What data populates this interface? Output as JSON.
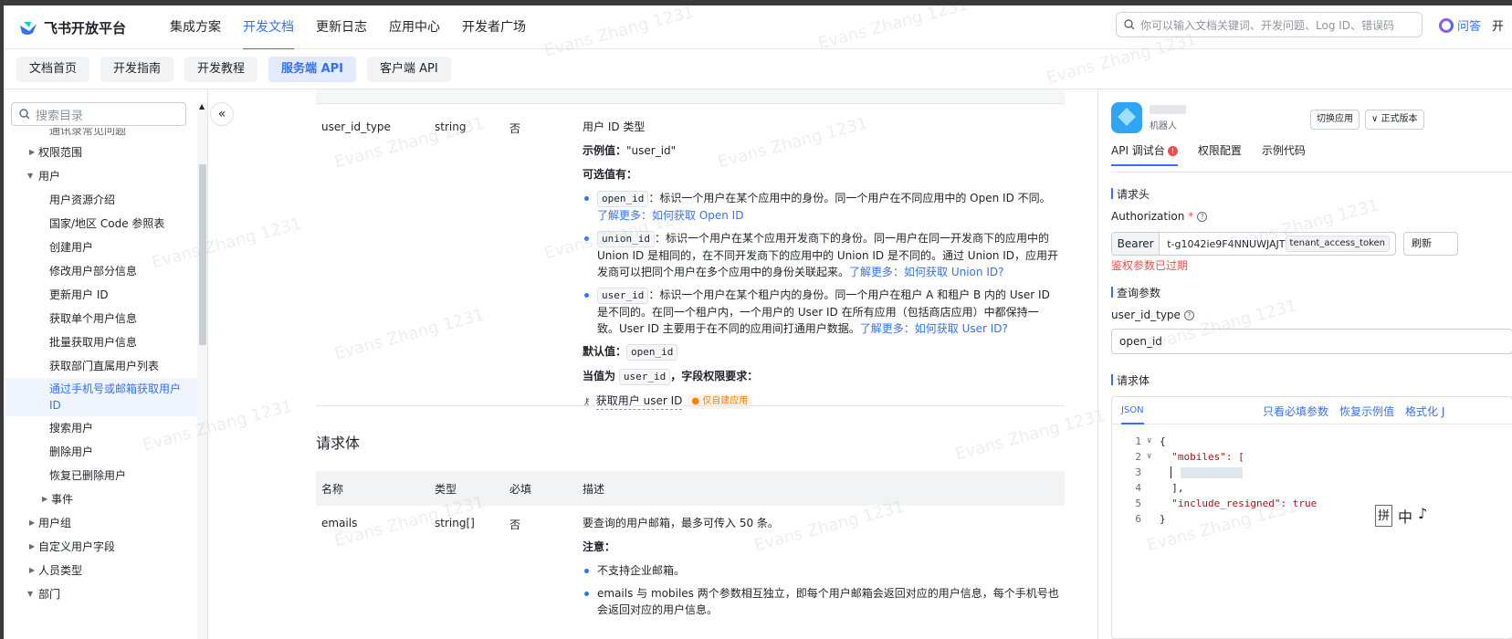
{
  "topbar": {
    "logo_text": "飞书开放平台",
    "nav": [
      "集成方案",
      "开发文档",
      "更新日志",
      "应用中心",
      "开发者广场"
    ],
    "active_nav": "开发文档",
    "search_placeholder": "你可以输入文档关键词、开发问题、Log ID、错误码",
    "ask_label": "问答",
    "more_label": "开"
  },
  "subnav": {
    "tabs": [
      "文档首页",
      "开发指南",
      "开发教程",
      "服务端 API",
      "客户端 API"
    ],
    "active": "服务端 API"
  },
  "sidebar": {
    "search_placeholder": "搜索目录",
    "items": [
      {
        "label": "通讯录常见问题",
        "level": 1,
        "arrow": ""
      },
      {
        "label": "权限范围",
        "level": 0,
        "arrow": "right"
      },
      {
        "label": "用户",
        "level": 0,
        "arrow": "down"
      },
      {
        "label": "用户资源介绍",
        "level": 1,
        "arrow": ""
      },
      {
        "label": "国家/地区 Code 参照表",
        "level": 1,
        "arrow": ""
      },
      {
        "label": "创建用户",
        "level": 1,
        "arrow": ""
      },
      {
        "label": "修改用户部分信息",
        "level": 1,
        "arrow": ""
      },
      {
        "label": "更新用户 ID",
        "level": 1,
        "arrow": ""
      },
      {
        "label": "获取单个用户信息",
        "level": 1,
        "arrow": ""
      },
      {
        "label": "批量获取用户信息",
        "level": 1,
        "arrow": ""
      },
      {
        "label": "获取部门直属用户列表",
        "level": 1,
        "arrow": ""
      },
      {
        "label": "通过手机号或邮箱获取用户 ID",
        "level": 1,
        "arrow": "",
        "selected": true
      },
      {
        "label": "搜索用户",
        "level": 1,
        "arrow": ""
      },
      {
        "label": "删除用户",
        "level": 1,
        "arrow": ""
      },
      {
        "label": "恢复已删除用户",
        "level": 1,
        "arrow": ""
      },
      {
        "label": "事件",
        "level": 2,
        "arrow": "right"
      },
      {
        "label": "用户组",
        "level": 0,
        "arrow": "right"
      },
      {
        "label": "自定义用户字段",
        "level": 0,
        "arrow": "right"
      },
      {
        "label": "人员类型",
        "level": 0,
        "arrow": "right"
      },
      {
        "label": "部门",
        "level": 0,
        "arrow": "down"
      }
    ]
  },
  "main": {
    "query_row": {
      "name": "user_id_type",
      "type": "string",
      "required": "否",
      "title": "用户 ID 类型",
      "example_label": "示例值：",
      "example_value": "\"user_id\"",
      "options_label": "可选值有：",
      "options": [
        {
          "code": "open_id",
          "text": "：标识一个用户在某个应用中的身份。同一个用户在不同应用中的 Open ID 不同。",
          "link": "了解更多：如何获取 Open ID"
        },
        {
          "code": "union_id",
          "text": "：标识一个用户在某个应用开发商下的身份。同一用户在同一开发商下的应用中的 Union ID 是相同的，在不同开发商下的应用中的 Union ID 是不同的。通过 Union ID，应用开发商可以把同个用户在多个应用中的身份关联起来。",
          "link": "了解更多：如何获取 Union ID?"
        },
        {
          "code": "user_id",
          "text": "：标识一个用户在某个租户内的身份。同一个用户在租户 A 和租户 B 内的 User ID 是不同的。在同一个租户内，一个用户的 User ID 在所有应用（包括商店应用）中都保持一致。User ID 主要用于在不同的应用间打通用户数据。",
          "link": "了解更多：如何获取 User ID?"
        }
      ],
      "default_label": "默认值：",
      "default_value": "open_id",
      "when_prefix": "当值为",
      "when_value": "user_id",
      "when_suffix": "，字段权限要求：",
      "perm_text": "获取用户 user ID",
      "perm_badge": "仅自建应用"
    },
    "body_title": "请求体",
    "headers": [
      "名称",
      "类型",
      "必填",
      "描述"
    ],
    "body_row": {
      "name": "emails",
      "type": "string[]",
      "required": "否",
      "desc": "要查询的用户邮箱，最多可传入 50 条。",
      "note_label": "注意：",
      "notes": [
        "不支持企业邮箱。",
        "emails 与 mobiles 两个参数相互独立，即每个用户邮箱会返回对应的用户信息，每个手机号也会返回对应的用户信息。"
      ]
    }
  },
  "right": {
    "app_role": "机器人",
    "switch_app": "切换应用",
    "version": "正式版本",
    "tabs": [
      "API 调试台",
      "权限配置",
      "示例代码"
    ],
    "error_badge": "!",
    "headers_title": "请求头",
    "auth_label": "Authorization",
    "auth_required_mark": "*",
    "bearer": "Bearer",
    "token": "t-g1042ie9F4NNUWJAJT",
    "token_type": "tenant_access_token",
    "refresh": "刷新",
    "auth_error": "鉴权参数已过期",
    "query_title": "查询参数",
    "query_label": "user_id_type",
    "query_value": "open_id",
    "body_title": "请求体",
    "json_tab": "JSON",
    "actions": [
      "只看必填参数",
      "恢复示例值",
      "格式化 J"
    ],
    "code_lines": [
      {
        "no": "1",
        "fold": "∨",
        "text": "{"
      },
      {
        "no": "2",
        "fold": "∨",
        "text": "  \"mobiles\": ["
      },
      {
        "no": "3",
        "fold": "",
        "text": ""
      },
      {
        "no": "4",
        "fold": "",
        "text": "  ],"
      },
      {
        "no": "5",
        "fold": "",
        "text": "  \"include_resigned\": true"
      },
      {
        "no": "6",
        "fold": "",
        "text": "}"
      }
    ],
    "ime": [
      "拼",
      "中",
      "♪"
    ]
  },
  "watermark": "Evans Zhang 1231"
}
